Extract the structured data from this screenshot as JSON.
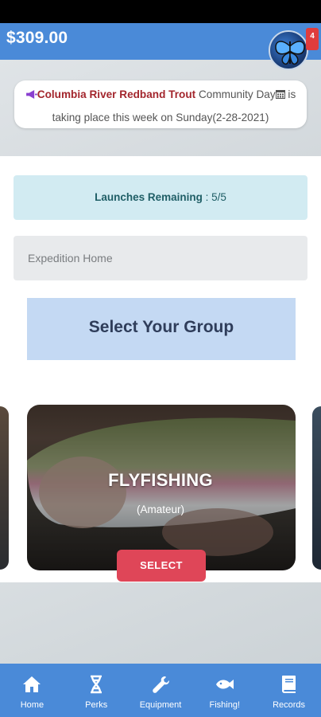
{
  "header": {
    "balance": "$309.00",
    "notification_count": "4"
  },
  "announcement": {
    "highlight": "Columbia River Redband Trout",
    "event": " Community Day",
    "rest": " is taking place this week on Sunday(2-28-2021)"
  },
  "launches": {
    "label": "Launches Remaining",
    "separator": " : ",
    "value": "5/5"
  },
  "expedition": {
    "label": "Expedition Home"
  },
  "group": {
    "title": "Select Your Group"
  },
  "carousel": {
    "current": {
      "title": "FLYFISHING",
      "subtitle": "(Amateur)",
      "button": "SELECT"
    }
  },
  "nav": {
    "items": [
      {
        "label": "Home",
        "icon": "home-icon"
      },
      {
        "label": "Perks",
        "icon": "dna-icon"
      },
      {
        "label": "Equipment",
        "icon": "wrench-icon"
      },
      {
        "label": "Fishing!",
        "icon": "fish-icon"
      },
      {
        "label": "Records",
        "icon": "book-icon"
      }
    ]
  },
  "colors": {
    "header_bg": "#4a8ad8",
    "select_button": "#df4658",
    "highlight_text": "#a3262d"
  }
}
